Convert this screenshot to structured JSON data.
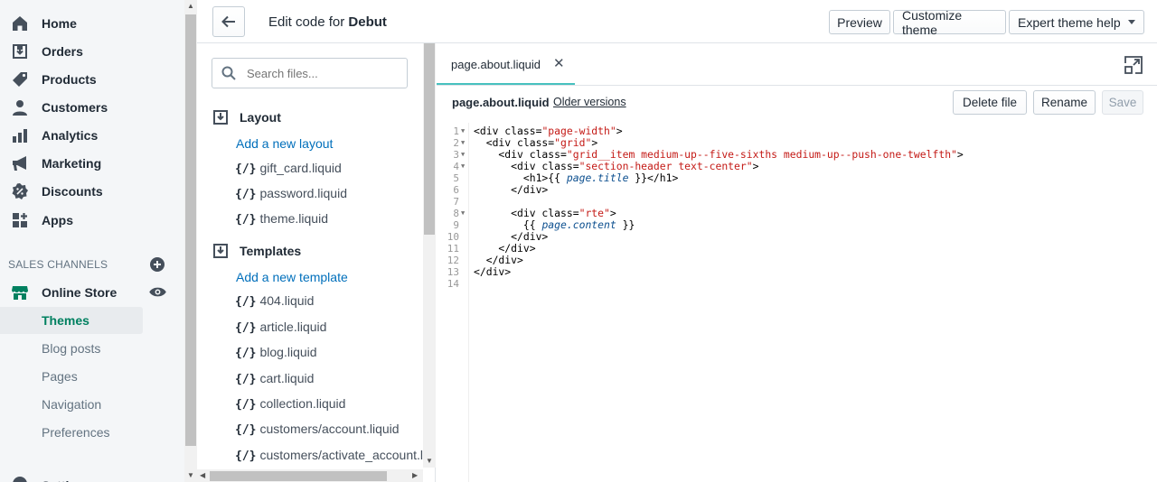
{
  "sidebar": {
    "nav": [
      {
        "label": "Home",
        "icon": "home-icon"
      },
      {
        "label": "Orders",
        "icon": "orders-icon"
      },
      {
        "label": "Products",
        "icon": "tag-icon"
      },
      {
        "label": "Customers",
        "icon": "person-icon"
      },
      {
        "label": "Analytics",
        "icon": "bar-chart-icon"
      },
      {
        "label": "Marketing",
        "icon": "megaphone-icon"
      },
      {
        "label": "Discounts",
        "icon": "discount-icon"
      },
      {
        "label": "Apps",
        "icon": "apps-icon"
      }
    ],
    "sales_channels_label": "SALES CHANNELS",
    "online_store": "Online Store",
    "sub_items": [
      "Themes",
      "Blog posts",
      "Pages",
      "Navigation",
      "Preferences"
    ],
    "active_sub_item": "Themes",
    "settings_partial": "Settings"
  },
  "topbar": {
    "title_prefix": "Edit code for ",
    "theme_name": "Debut",
    "preview": "Preview",
    "customize": "Customize theme",
    "expert": "Expert theme help"
  },
  "files": {
    "search_placeholder": "Search files...",
    "layout": {
      "heading": "Layout",
      "add_link": "Add a new layout",
      "items": [
        "gift_card.liquid",
        "password.liquid",
        "theme.liquid"
      ]
    },
    "templates": {
      "heading": "Templates",
      "add_link": "Add a new template",
      "items": [
        "404.liquid",
        "article.liquid",
        "blog.liquid",
        "cart.liquid",
        "collection.liquid",
        "customers/account.liquid",
        "customers/activate_account.liquid"
      ]
    },
    "file_glyph": "{/}"
  },
  "editor": {
    "tab_label": "page.about.liquid",
    "file_name": "page.about.liquid",
    "older_versions": "Older versions",
    "delete": "Delete file",
    "rename": "Rename",
    "save": "Save",
    "line_numbers": [
      "1",
      "2",
      "3",
      "4",
      "5",
      "6",
      "7",
      "8",
      "9",
      "10",
      "11",
      "12",
      "13",
      "14"
    ],
    "fold_lines": [
      1,
      2,
      3,
      4,
      8
    ]
  },
  "colors": {
    "accent_green": "#008060",
    "link_blue": "#006fbb",
    "tab_underline": "#47c1bf",
    "string_red": "#c41a16"
  }
}
